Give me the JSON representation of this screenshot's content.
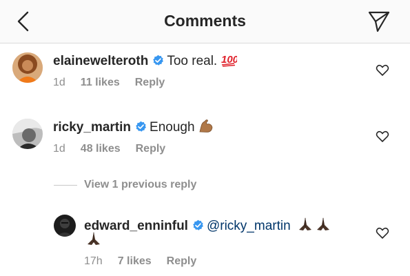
{
  "header": {
    "title": "Comments"
  },
  "comments": [
    {
      "username": "elainewelteroth",
      "text": "Too real.",
      "emoji": "hundred-points",
      "time": "1d",
      "likes": "11 likes",
      "reply": "Reply"
    },
    {
      "username": "ricky_martin",
      "text": "Enough",
      "emoji": "flexed-biceps",
      "time": "1d",
      "likes": "48 likes",
      "reply": "Reply"
    }
  ],
  "view_previous": "View 1 previous reply",
  "reply_comment": {
    "username": "edward_enninful",
    "mention": "@ricky_martin",
    "emoji": "folded-hands",
    "time": "17h",
    "likes": "7 likes",
    "reply": "Reply"
  },
  "colors": {
    "verified": "#3897f0",
    "meta": "#8e8e8e",
    "mention": "#003569"
  }
}
